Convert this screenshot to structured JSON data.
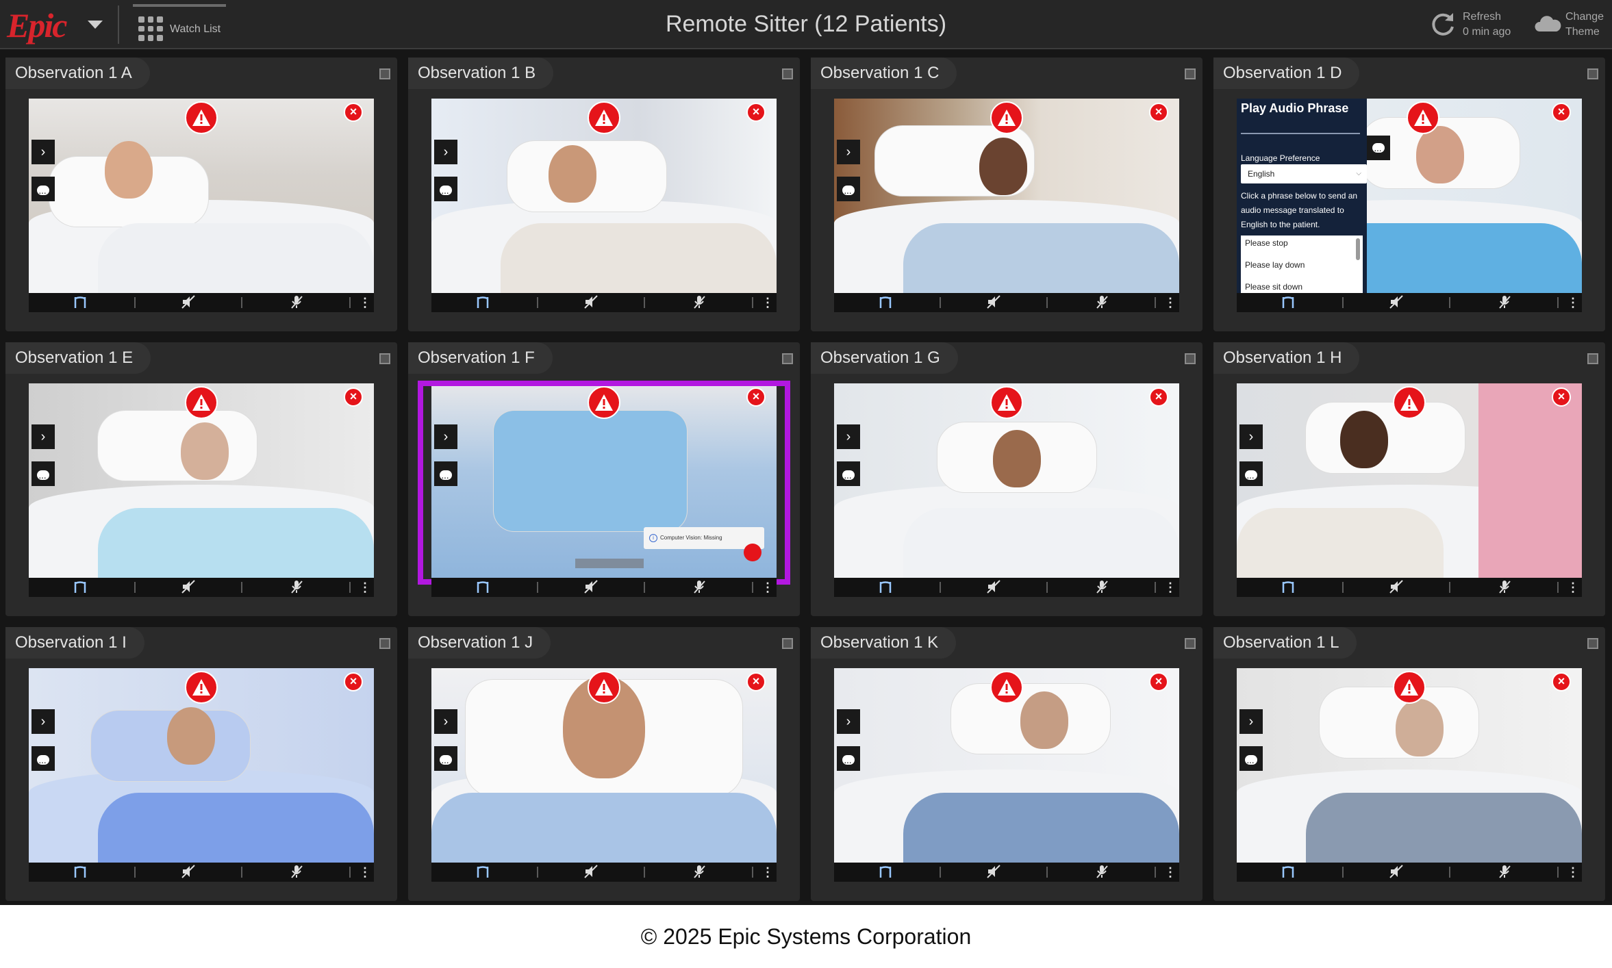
{
  "header": {
    "logo": "Epic",
    "watch_list_label": "Watch List",
    "title": "Remote Sitter (12 Patients)",
    "refresh_label": "Refresh",
    "refresh_time": "0 min ago",
    "theme_label_line1": "Change",
    "theme_label_line2": "Theme"
  },
  "tiles": [
    {
      "label": "Observation 1 A"
    },
    {
      "label": "Observation 1 B"
    },
    {
      "label": "Observation 1 C"
    },
    {
      "label": "Observation 1 D"
    },
    {
      "label": "Observation 1 E"
    },
    {
      "label": "Observation 1 F"
    },
    {
      "label": "Observation 1 G"
    },
    {
      "label": "Observation 1 H"
    },
    {
      "label": "Observation 1 I"
    },
    {
      "label": "Observation 1 J"
    },
    {
      "label": "Observation 1 K"
    },
    {
      "label": "Observation 1 L"
    }
  ],
  "audio_panel": {
    "title": "Play Audio Phrase",
    "language_label": "Language Preference",
    "language_value": "English",
    "description": "Click a phrase below to send an audio message translated to English to the patient.",
    "phrases": [
      "Please stop",
      "Please lay down",
      "Please sit down"
    ]
  },
  "alert_toast": {
    "text": "Computer Vision: Missing"
  },
  "colors": {
    "alert_red": "#e5141a",
    "highlight_purple": "#b218e0",
    "brand_red": "#d8242c"
  },
  "footer": {
    "copyright": "© 2025 Epic Systems Corporation"
  }
}
